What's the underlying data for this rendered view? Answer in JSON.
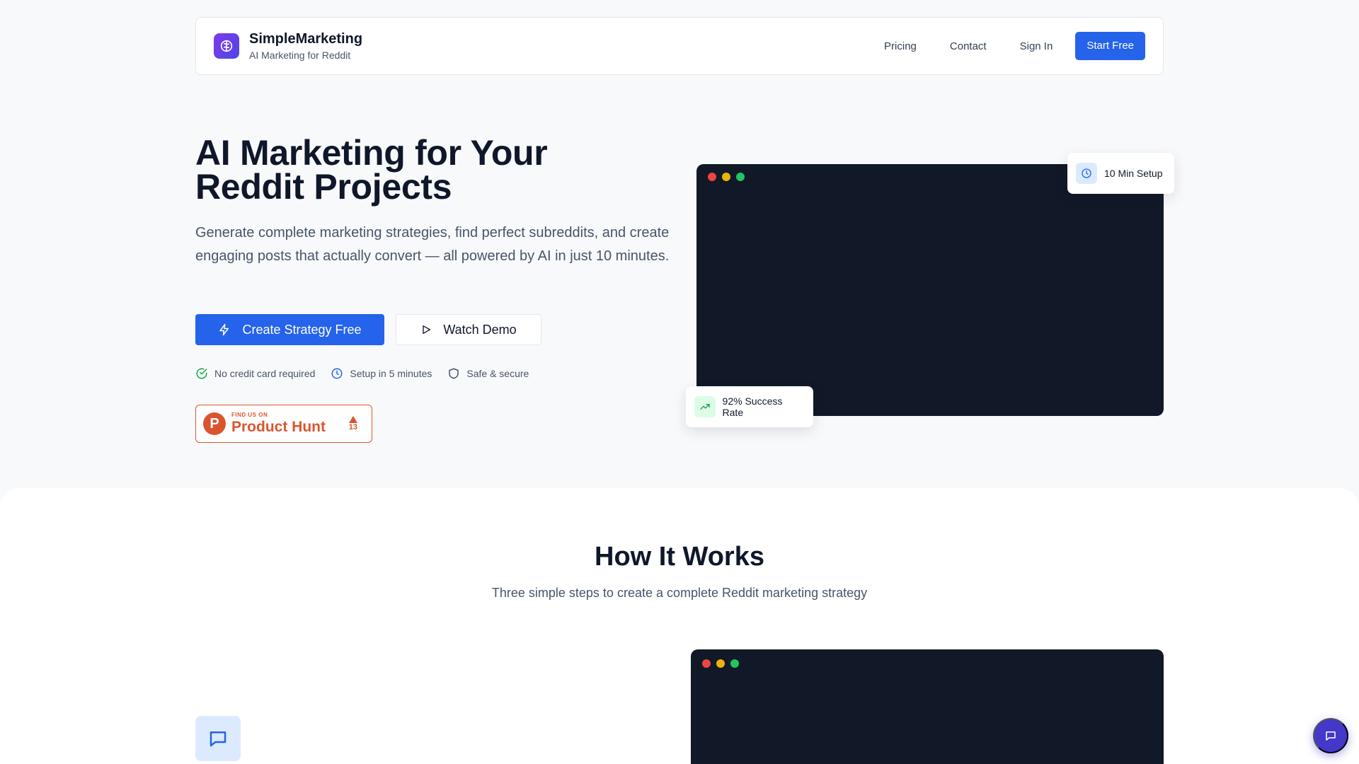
{
  "nav": {
    "brand_name": "SimpleMarketing",
    "brand_tagline": "AI Marketing for Reddit",
    "links": [
      "Pricing",
      "Contact",
      "Sign In"
    ],
    "cta": "Start Free"
  },
  "hero": {
    "title_line1": "AI Marketing for Your",
    "title_line2": "Reddit Projects",
    "subtitle": "Generate complete marketing strategies, find perfect subreddits, and create engaging posts that actually convert — all powered by AI in just 10 minutes.",
    "primary_cta": "Create Strategy Free",
    "secondary_cta": "Watch Demo",
    "trust": [
      "No credit card required",
      "Setup in 5 minutes",
      "Safe & secure"
    ],
    "producthunt": {
      "small": "FIND US ON",
      "big": "Product Hunt",
      "votes": "13"
    },
    "float_setup": "10 Min Setup",
    "float_success": "92% Success Rate"
  },
  "how": {
    "title": "How It Works",
    "subtitle": "Three simple steps to create a complete Reddit marketing strategy"
  },
  "colors": {
    "primary": "#2563eb",
    "producthunt": "#da552f",
    "dark_window": "#111827",
    "chat_fab": "#4338ca"
  },
  "icons": [
    "brain-icon",
    "zap-icon",
    "play-icon",
    "check-circle-icon",
    "clock-icon",
    "shield-icon",
    "trending-up-icon",
    "message-square-icon",
    "chat-icon"
  ]
}
